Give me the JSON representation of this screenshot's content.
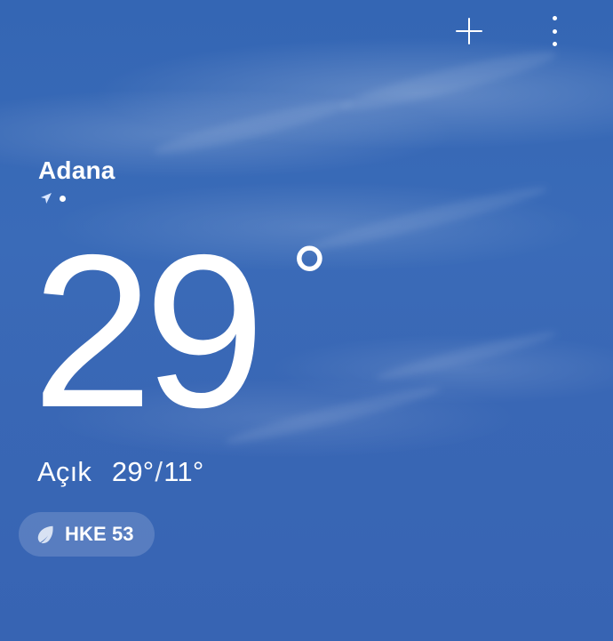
{
  "weather": {
    "city": "Adana",
    "temperature": "29",
    "temperature_unit": "°",
    "condition": "Açık",
    "range": {
      "high": "29°",
      "separator": "/",
      "low": "11°"
    },
    "air_quality": {
      "label": "HKE 53"
    }
  },
  "icons": {
    "add": "plus-icon",
    "menu": "kebab-menu-icon",
    "location": "location-arrow-icon",
    "air_quality": "leaf-icon"
  },
  "colors": {
    "sky_blue": "#3466b4",
    "text_white": "#ffffff"
  }
}
